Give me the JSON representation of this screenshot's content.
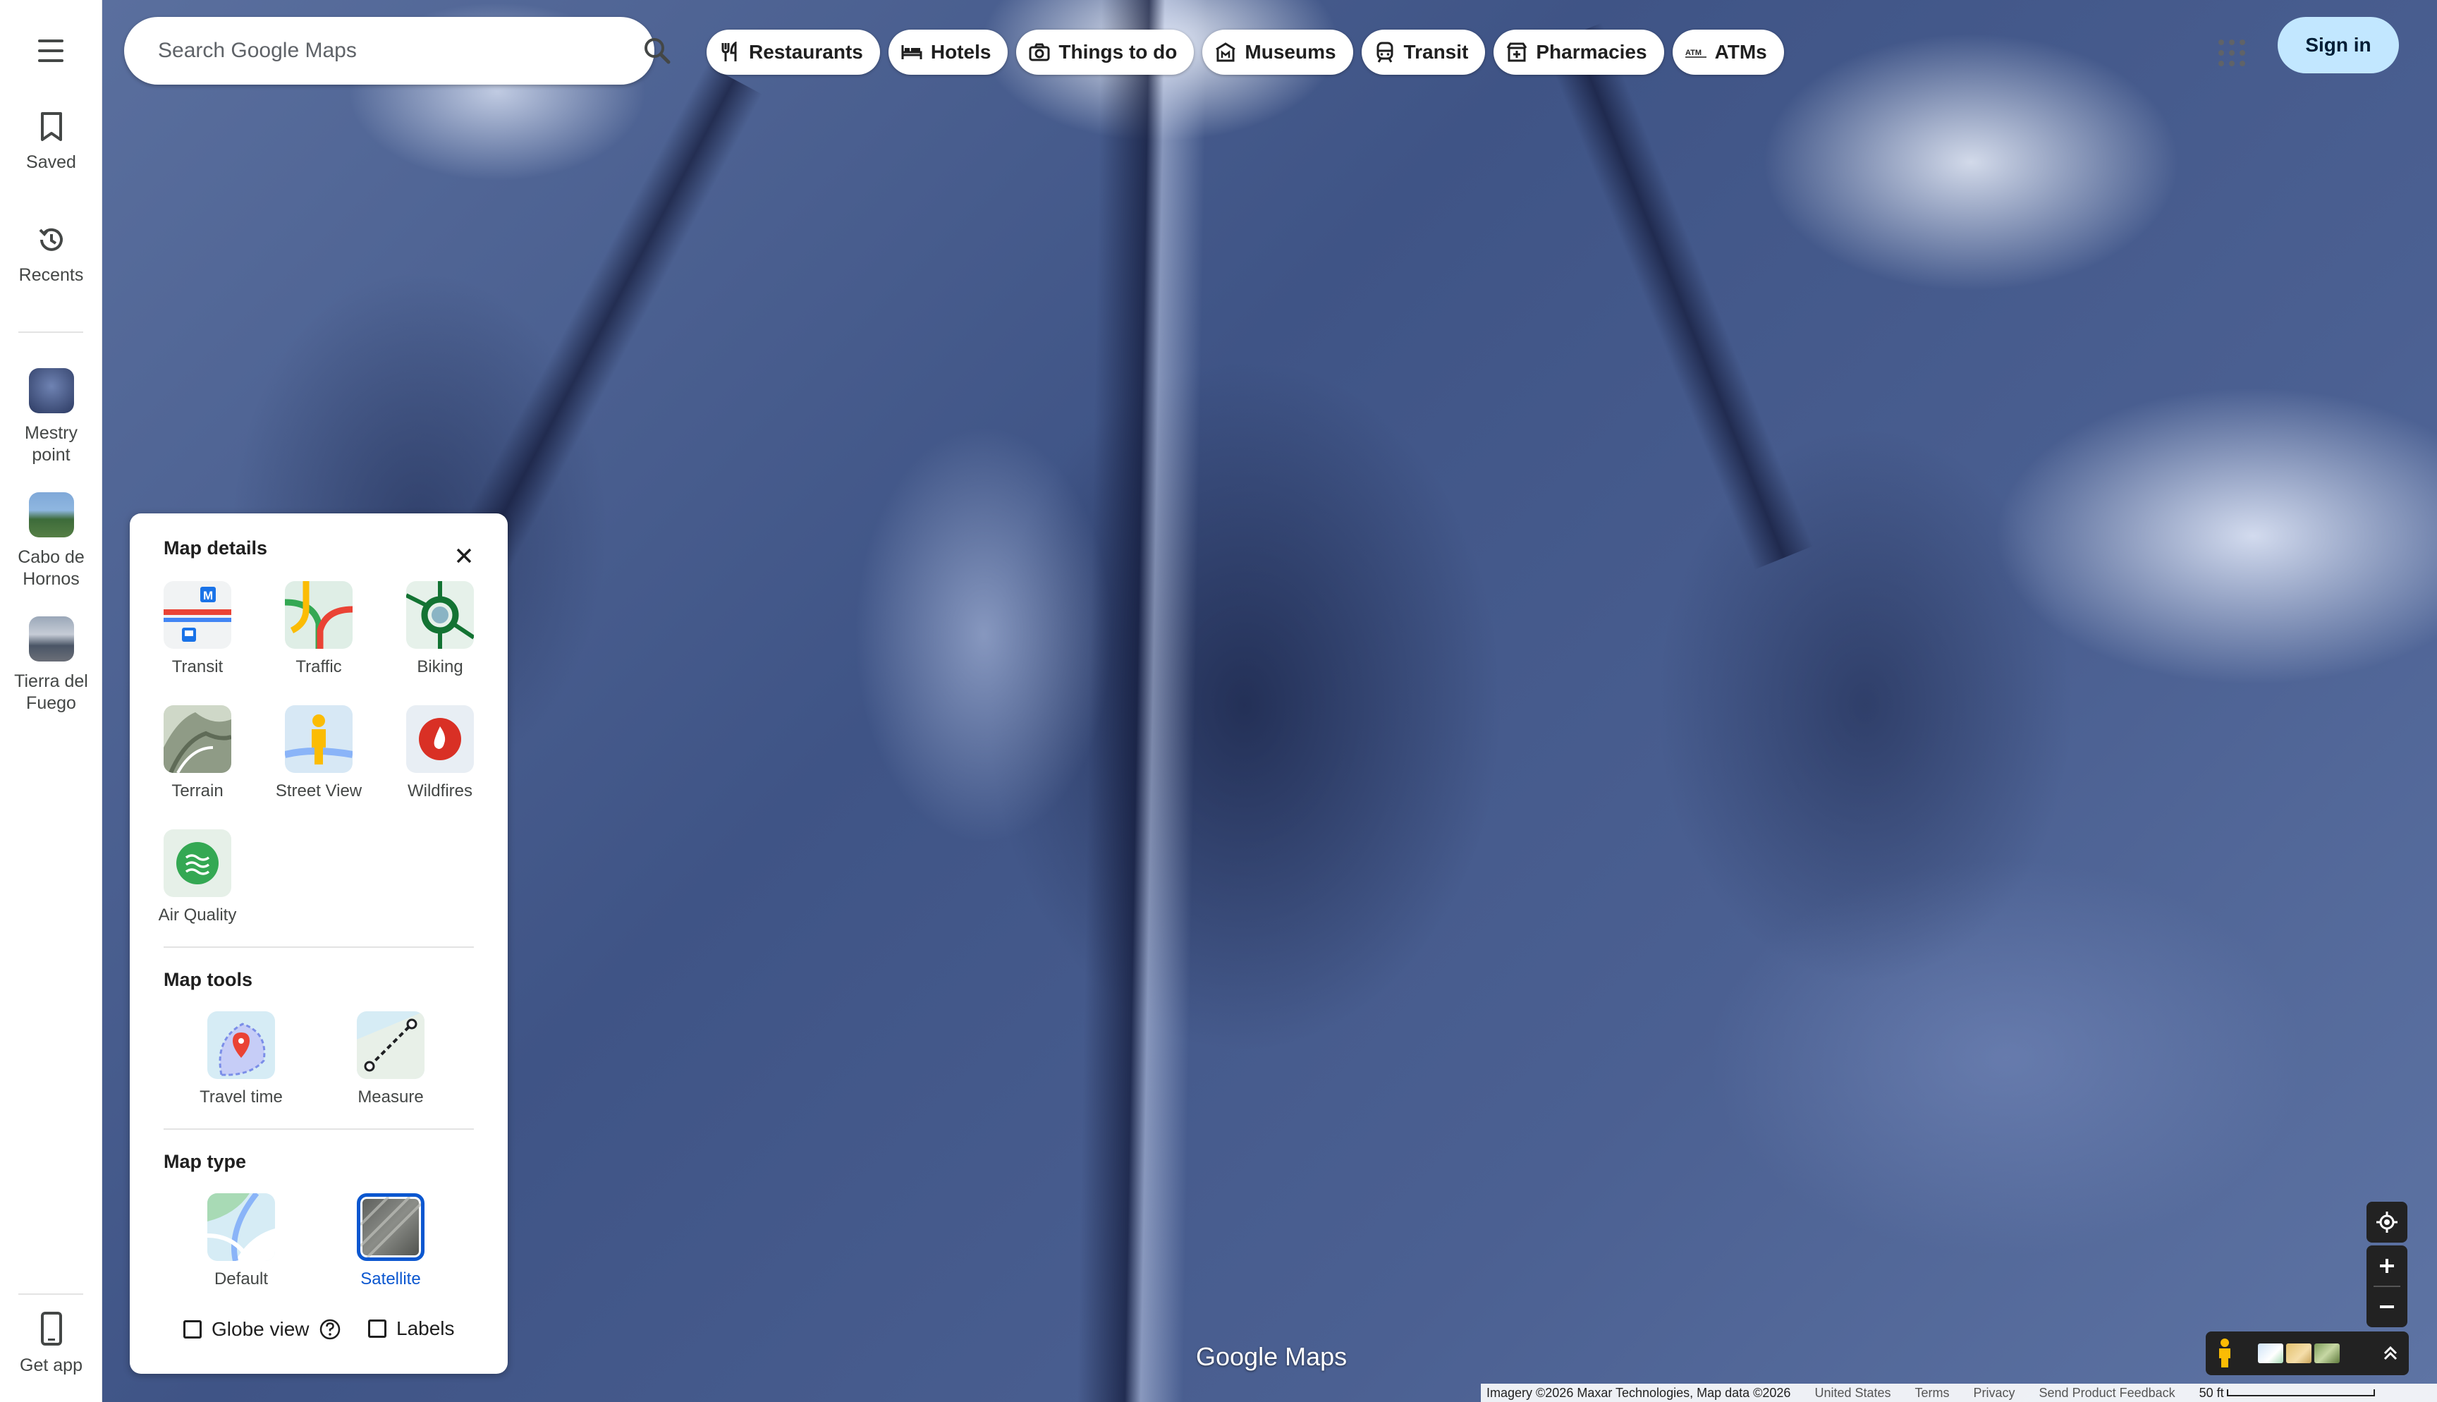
{
  "search": {
    "placeholder": "Search Google Maps",
    "search_icon": "search-icon",
    "directions_icon": "directions-icon"
  },
  "chips": [
    {
      "label": "Restaurants",
      "icon": "fork-knife-icon"
    },
    {
      "label": "Hotels",
      "icon": "bed-icon"
    },
    {
      "label": "Things to do",
      "icon": "camera-icon"
    },
    {
      "label": "Museums",
      "icon": "museum-icon"
    },
    {
      "label": "Transit",
      "icon": "train-icon"
    },
    {
      "label": "Pharmacies",
      "icon": "pharmacy-icon"
    },
    {
      "label": "ATMs",
      "icon": "atm-icon"
    }
  ],
  "header": {
    "sign_in": "Sign in",
    "apps_icon": "apps-grid-icon"
  },
  "rail": {
    "saved": "Saved",
    "recents": "Recents",
    "recent_places": [
      {
        "line1": "Mestry",
        "line2": "point"
      },
      {
        "line1": "Cabo de",
        "line2": "Hornos"
      },
      {
        "line1": "Tierra del",
        "line2": "Fuego"
      }
    ],
    "get_app": "Get app"
  },
  "panel": {
    "map_details_title": "Map details",
    "details": [
      {
        "label": "Transit",
        "icon": "transit-layer-icon"
      },
      {
        "label": "Traffic",
        "icon": "traffic-layer-icon"
      },
      {
        "label": "Biking",
        "icon": "biking-layer-icon"
      },
      {
        "label": "Terrain",
        "icon": "terrain-layer-icon"
      },
      {
        "label": "Street View",
        "icon": "street-view-layer-icon"
      },
      {
        "label": "Wildfires",
        "icon": "wildfires-layer-icon"
      },
      {
        "label": "Air Quality",
        "icon": "air-quality-layer-icon"
      }
    ],
    "map_tools_title": "Map tools",
    "tools": [
      {
        "label": "Travel time",
        "icon": "travel-time-icon"
      },
      {
        "label": "Measure",
        "icon": "measure-icon"
      }
    ],
    "map_type_title": "Map type",
    "types": [
      {
        "label": "Default",
        "selected": false
      },
      {
        "label": "Satellite",
        "selected": true
      }
    ],
    "globe_view": "Globe view",
    "globe_view_checked": false,
    "labels": "Labels",
    "labels_checked": false
  },
  "map": {
    "brand": "Google Maps"
  },
  "footer": {
    "imagery": "Imagery ©2026 Maxar Technologies, Map data ©2026",
    "country": "United States",
    "terms": "Terms",
    "privacy": "Privacy",
    "feedback": "Send Product Feedback",
    "scale": "50 ft"
  },
  "colors": {
    "accent": "#0b57d0",
    "sign_in_bg": "#c2e7ff",
    "directions": "#1a73e8"
  }
}
